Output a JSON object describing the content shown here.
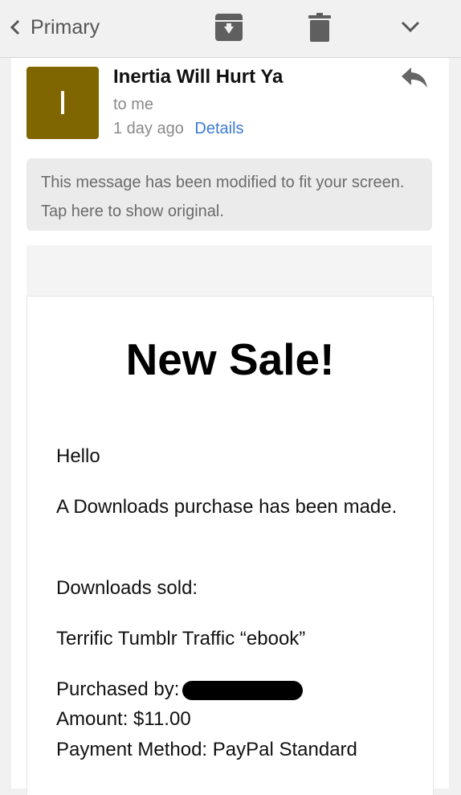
{
  "topbar": {
    "back_label": "Primary",
    "icons": [
      "chevron-left-icon",
      "archive-icon",
      "trash-icon",
      "chevron-down-icon"
    ]
  },
  "message": {
    "avatar_letter": "I",
    "sender": "Inertia Will Hurt Ya",
    "to": "to me",
    "time": "1 day ago",
    "details_label": "Details",
    "notice": "This message has been modified to fit your screen. Tap here to show original."
  },
  "body": {
    "headline": "New Sale!",
    "greeting": "Hello",
    "purchase_line": "A Downloads purchase has been made.",
    "downloads_label": "Downloads sold:",
    "product": "Terrific Tumblr Traffic “ebook”",
    "purchased_by_label": "Purchased by:",
    "amount": "Amount: $11.00",
    "payment": "Payment Method: PayPal Standard"
  },
  "colors": {
    "avatar": "#806600",
    "link": "#3b7bd3",
    "background": "#f1f1f1"
  }
}
